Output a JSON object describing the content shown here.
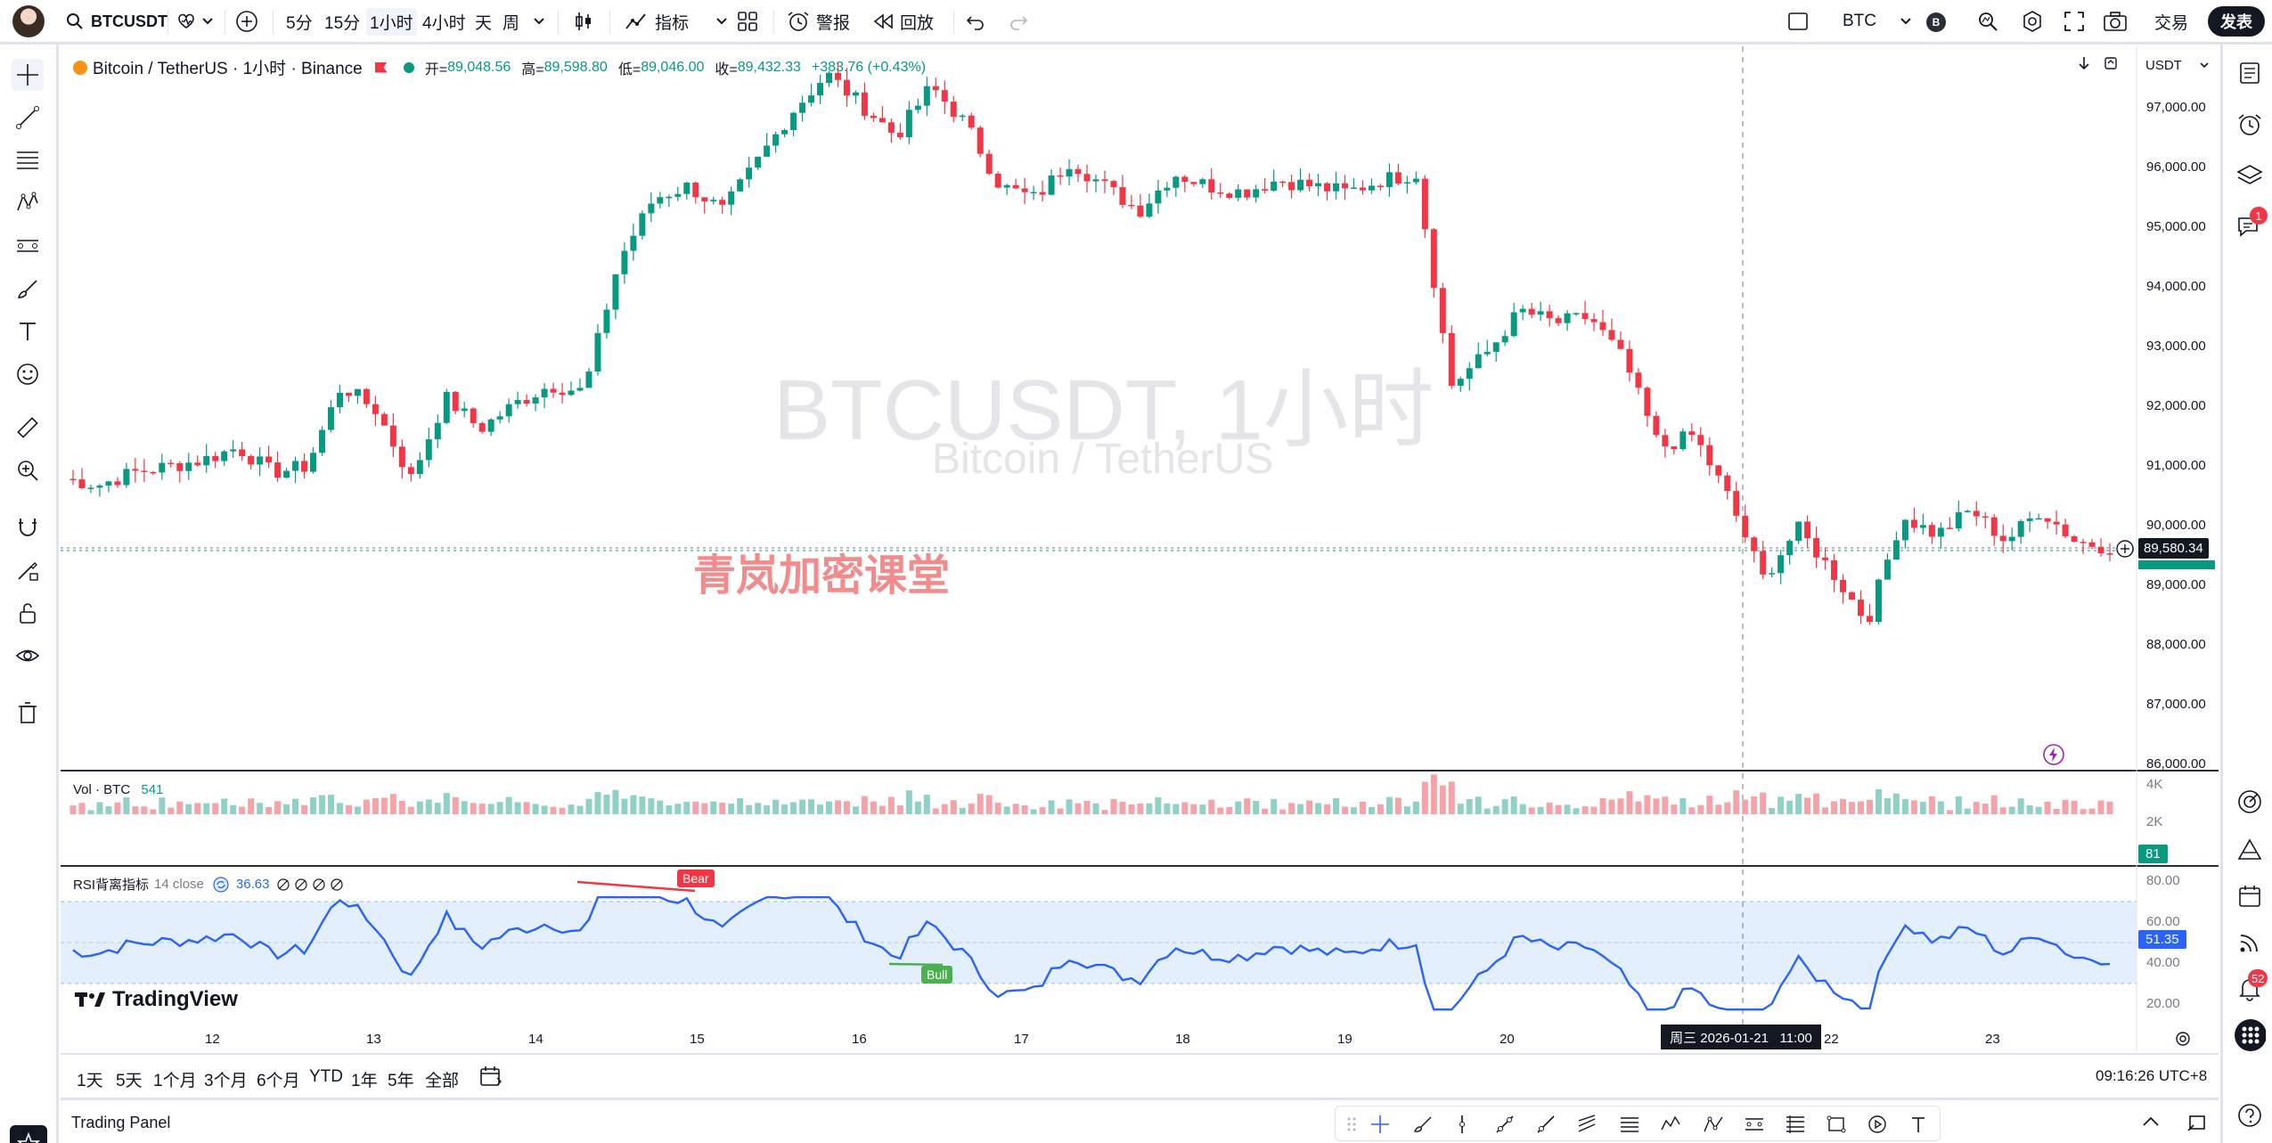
{
  "topbar": {
    "symbol": "BTCUSDT",
    "timeframes": [
      "5分",
      "15分",
      "1小时",
      "4小时",
      "天",
      "周"
    ],
    "active_timeframe": "1小时",
    "indicators_label": "指标",
    "alert_label": "警报",
    "replay_label": "回放",
    "currency": "BTC",
    "currency_badge": "B",
    "trade_label": "交易",
    "publish_label": "发表"
  },
  "legend": {
    "title": "Bitcoin / TetherUS · 1小时 · Binance",
    "open_label": "开=",
    "open": "89,048.56",
    "high_label": "高=",
    "high": "89,598.80",
    "low_label": "低=",
    "low": "89,046.00",
    "close_label": "收=",
    "close": "89,432.33",
    "change": "+383.76 (+0.43%)",
    "price_currency": "USDT"
  },
  "watermark": {
    "main": "BTCUSDT, 1小时",
    "sub": "Bitcoin / TetherUS",
    "overlay": "青岚加密课堂",
    "brand": "TradingView"
  },
  "price_axis": {
    "labels": [
      "97,000.00",
      "96,000.00",
      "95,000.00",
      "94,000.00",
      "93,000.00",
      "92,000.00",
      "91,000.00",
      "90,000.00",
      "89,000.00",
      "88,000.00",
      "87,000.00",
      "86,000.00"
    ],
    "current_price": "89,580.34"
  },
  "volume_pane": {
    "title": "Vol · BTC",
    "value": "541",
    "axis_labels": [
      "4K",
      "2K"
    ],
    "current": "81"
  },
  "rsi_pane": {
    "title": "RSI背离指标",
    "params": "14 close",
    "value": "36.63",
    "axis_labels": [
      "80.00",
      "60.00",
      "40.00",
      "20.00"
    ],
    "current": "51.35",
    "bear_label": "Bear",
    "bull_label": "Bull",
    "pane_icons": [
      "eye-off-icon",
      "eye-off-icon",
      "eye-off-icon",
      "eye-off-icon"
    ]
  },
  "time_axis": {
    "labels": [
      "12",
      "13",
      "14",
      "15",
      "16",
      "17",
      "18",
      "19",
      "20",
      "22",
      "23"
    ],
    "crosshair_label": "周三 2026-01-21   11:00"
  },
  "range_bar": {
    "ranges": [
      "1天",
      "5天",
      "1个月",
      "3个月",
      "6个月",
      "YTD",
      "1年",
      "5年",
      "全部"
    ],
    "clock": "09:16:26 UTC+8"
  },
  "panel_bar": {
    "label": "Trading Panel"
  },
  "right_sidebar": {
    "chat_badge": "1",
    "alerts_badge": "52"
  },
  "colors": {
    "up": "#089981",
    "down": "#f23645",
    "rsi_line": "#2962ff",
    "rsi_band": "#e3effd",
    "watermark_overlay": "#f28b8b"
  },
  "chart_data": {
    "type": "candlestick",
    "symbol": "BTCUSDT",
    "interval": "1小时",
    "x_ticks": [
      "12",
      "13",
      "14",
      "15",
      "16",
      "17",
      "18",
      "19",
      "20",
      "22",
      "23"
    ],
    "y_range": [
      86000,
      97300
    ],
    "close_path": [
      90500,
      90400,
      90600,
      90700,
      90800,
      91000,
      90600,
      90700,
      92000,
      91600,
      90500,
      91800,
      91300,
      91700,
      92000,
      91900,
      94000,
      95000,
      95200,
      94800,
      95600,
      96400,
      97000,
      96500,
      96000,
      96800,
      96200,
      95200,
      95000,
      95600,
      95200,
      94800,
      95400,
      95200,
      95100,
      95300,
      95200,
      95100,
      95300,
      95400,
      92000,
      92500,
      93200,
      93000,
      93100,
      92400,
      91000,
      91200,
      90200,
      88900,
      89700,
      89000,
      88200,
      89900,
      89600,
      90000,
      89500,
      90000,
      89500,
      89400
    ]
  }
}
